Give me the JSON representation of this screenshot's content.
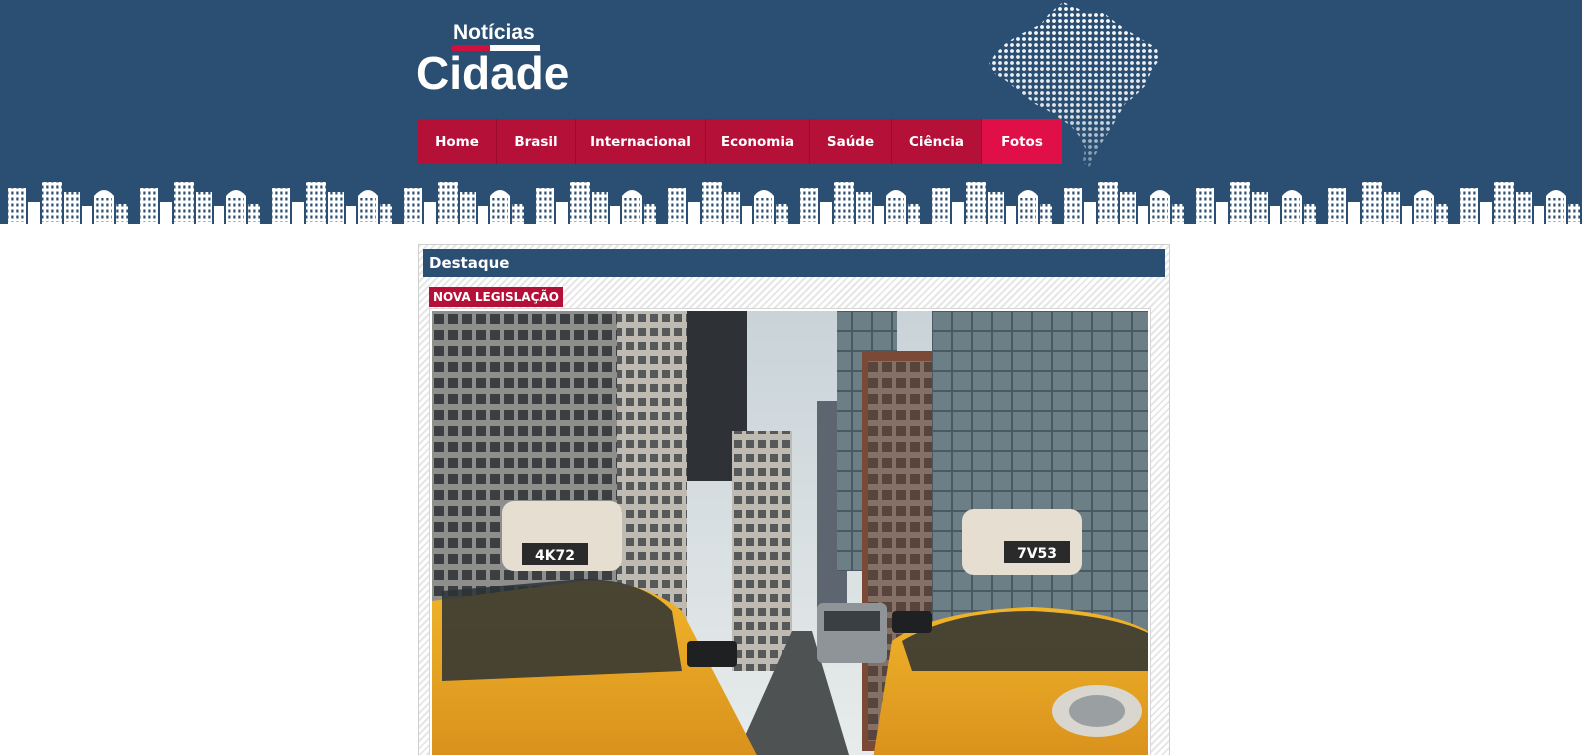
{
  "logo": {
    "top_text": "Notícias",
    "main_text": "Cidade"
  },
  "nav": {
    "items": [
      {
        "label": "Home"
      },
      {
        "label": "Brasil"
      },
      {
        "label": "Internacional"
      },
      {
        "label": "Economia"
      },
      {
        "label": "Saúde"
      },
      {
        "label": "Ciência"
      },
      {
        "label": "Fotos"
      }
    ],
    "active": "Fotos"
  },
  "featured": {
    "section_title": "Destaque",
    "tag": "NOVA LEGISLAÇÃO",
    "photo": {
      "left_plate": "4K72",
      "right_plate": "7V53"
    }
  },
  "colors": {
    "header_bg": "#2b4f73",
    "nav_bg": "#b41038",
    "nav_active": "#e00f47",
    "tag_bg": "#b41038"
  },
  "icons": [
    "brazil-map-icon",
    "city-skyline"
  ]
}
